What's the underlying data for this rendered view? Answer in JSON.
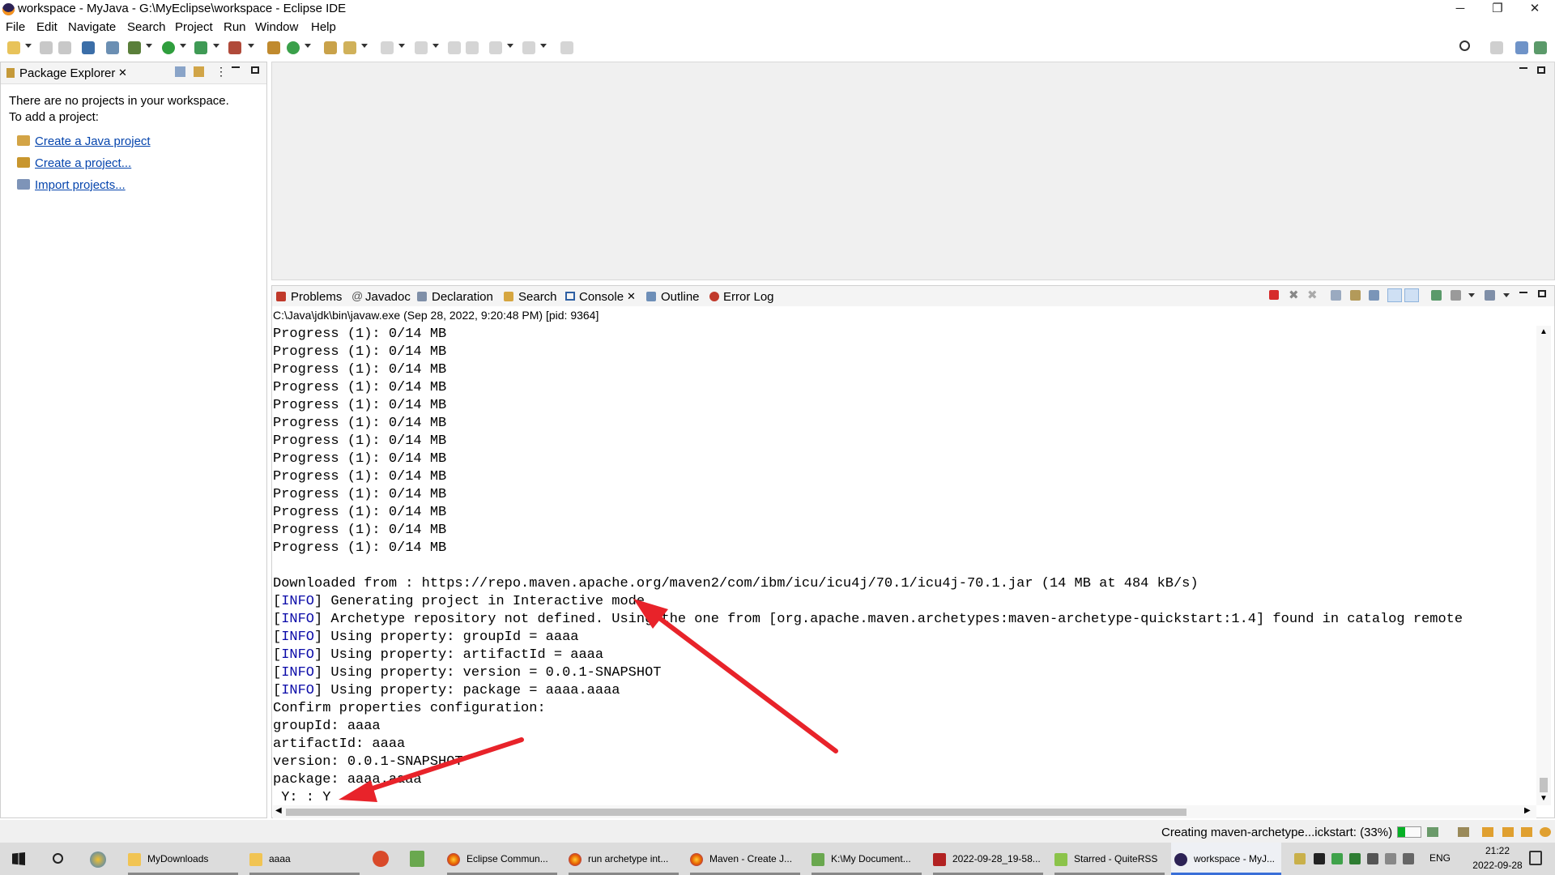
{
  "window": {
    "title": "workspace - MyJava - G:\\MyEclipse\\workspace - Eclipse IDE",
    "minimize_glyph": "─",
    "restore_glyph": "❐",
    "close_glyph": "✕"
  },
  "menu": [
    "File",
    "Edit",
    "Navigate",
    "Search",
    "Project",
    "Run",
    "Window",
    "Help"
  ],
  "package_explorer": {
    "tab_label": "Package Explorer",
    "close_glyph": "✕",
    "empty_message_1": "There are no projects in your workspace.",
    "empty_message_2": "To add a project:",
    "links": [
      "Create a Java project",
      "Create a project...",
      "Import projects..."
    ]
  },
  "console_view": {
    "tabs": [
      "Problems",
      "Javadoc",
      "Declaration",
      "Search",
      "Console",
      "Outline",
      "Error Log"
    ],
    "active_tab": "Console",
    "close_glyph": "✕",
    "process_line": "C:\\Java\\jdk\\bin\\javaw.exe (Sep 28, 2022, 9:20:48 PM) [pid: 9364]",
    "progress_line": "Progress (1): 0/14 MB",
    "progress_count": 13,
    "output": [
      {
        "tag": "",
        "text": "Downloaded from : https://repo.maven.apache.org/maven2/com/ibm/icu/icu4j/70.1/icu4j-70.1.jar (14 MB at 484 kB/s)"
      },
      {
        "tag": "INFO",
        "text": " Generating project in Interactive mode"
      },
      {
        "tag": "INFO",
        "text": " Archetype repository not defined. Using the one from [org.apache.maven.archetypes:maven-archetype-quickstart:1.4] found in catalog remote"
      },
      {
        "tag": "INFO",
        "text": " Using property: groupId = aaaa"
      },
      {
        "tag": "INFO",
        "text": " Using property: artifactId = aaaa"
      },
      {
        "tag": "INFO",
        "text": " Using property: version = 0.0.1-SNAPSHOT"
      },
      {
        "tag": "INFO",
        "text": " Using property: package = aaaa.aaaa"
      },
      {
        "tag": "",
        "text": "Confirm properties configuration:"
      },
      {
        "tag": "",
        "text": "groupId: aaaa"
      },
      {
        "tag": "",
        "text": "artifactId: aaaa"
      },
      {
        "tag": "",
        "text": "version: 0.0.1-SNAPSHOT"
      },
      {
        "tag": "",
        "text": "package: aaaa.aaaa"
      },
      {
        "tag": "",
        "text": " Y: : Y"
      }
    ]
  },
  "status": {
    "progress_text": "Creating maven-archetype...ickstart: (33%)",
    "progress_fraction": 0.33
  },
  "taskbar": {
    "items": [
      {
        "label": "MyDownloads",
        "icon": "folder-icon"
      },
      {
        "label": "aaaa",
        "icon": "folder-icon"
      },
      {
        "label": "Eclipse Commun...",
        "icon": "firefox-icon"
      },
      {
        "label": "run archetype int...",
        "icon": "firefox-icon"
      },
      {
        "label": "Maven - Create J...",
        "icon": "firefox-icon"
      },
      {
        "label": "K:\\My Document...",
        "icon": "notepad-icon"
      },
      {
        "label": "2022-09-28_19-58...",
        "icon": "image-icon"
      },
      {
        "label": "Starred - QuiteRSS",
        "icon": "rss-icon"
      },
      {
        "label": "workspace - MyJ...",
        "icon": "eclipse-icon"
      }
    ],
    "lang": "ENG",
    "time": "21:22",
    "date": "2022-09-28"
  },
  "colors": {
    "info_tag": "#0a0aa8",
    "link": "#0645ad",
    "annotation_arrow": "#e8232a"
  }
}
